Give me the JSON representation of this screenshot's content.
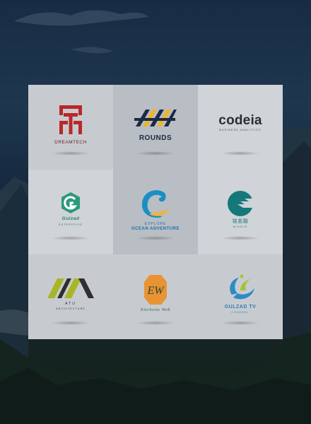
{
  "tiles": [
    {
      "name": "DREAMTECH",
      "sub": "",
      "icon": "dreamtech-logo-icon",
      "color": "#b8282a"
    },
    {
      "name": "ROUNDS",
      "sub": "",
      "icon": "rounds-logo-icon",
      "color": "#f2b51a"
    },
    {
      "name": "codeia",
      "sub": "BUSINESS ANALYTICS",
      "icon": "codeia-logo-icon",
      "color": "#2a2d33"
    },
    {
      "name": "Gulzad",
      "sub": "ENTERPRISE",
      "icon": "gulzad-logo-icon",
      "color": "#2a9a7a"
    },
    {
      "name_top": "EXPLORE",
      "name": "OCEAN ADVENTURE",
      "icon": "ocean-wave-logo-icon",
      "color": "#1b8fc4"
    },
    {
      "name": "铭金融",
      "sub": "MINGJR",
      "icon": "mingjinrong-logo-icon",
      "color": "#14787a"
    },
    {
      "name": "ATU",
      "sub": "ARCHITECTURE",
      "icon": "atu-logo-icon",
      "color": "#a9b624"
    },
    {
      "name": "Etichette Web",
      "monogram": "EW",
      "icon": "etichette-web-logo-icon",
      "color": "#e89334"
    },
    {
      "name": "GULZAD TV",
      "sub": "CHANNEL",
      "icon": "gulzad-tv-logo-icon",
      "color": "#2f8ac4"
    }
  ]
}
